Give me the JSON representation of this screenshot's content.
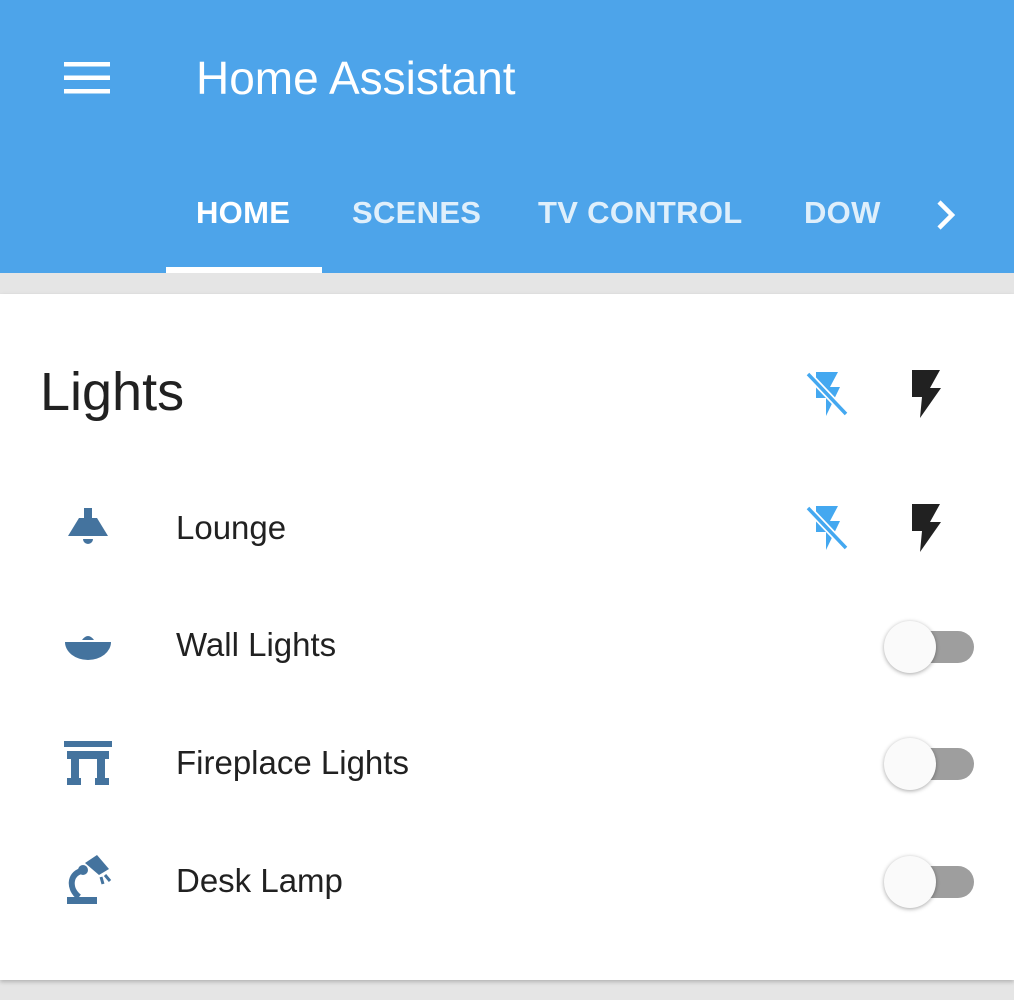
{
  "app": {
    "title": "Home Assistant",
    "menu_icon": "menu-icon",
    "colors": {
      "header": "#4da4ea",
      "accent": "#44a8f0",
      "icon": "#44739e",
      "text": "#212121"
    }
  },
  "tabs": [
    {
      "label": "HOME",
      "active": true
    },
    {
      "label": "SCENES",
      "active": false
    },
    {
      "label": "TV CONTROL",
      "active": false
    },
    {
      "label": "DOW",
      "active": false
    }
  ],
  "tab_scroll_icon": "chevron-right-icon",
  "card": {
    "title": "Lights",
    "group_controls": {
      "off_icon": "flash-off-icon",
      "on_icon": "flash-icon"
    },
    "entities": [
      {
        "name": "Lounge",
        "icon": "ceiling-light-icon",
        "control": "buttons"
      },
      {
        "name": "Wall Lights",
        "icon": "wall-bowl-light-icon",
        "control": "toggle",
        "state": "off"
      },
      {
        "name": "Fireplace Lights",
        "icon": "fireplace-icon",
        "control": "toggle",
        "state": "off"
      },
      {
        "name": "Desk Lamp",
        "icon": "desk-lamp-icon",
        "control": "toggle",
        "state": "off"
      }
    ]
  }
}
